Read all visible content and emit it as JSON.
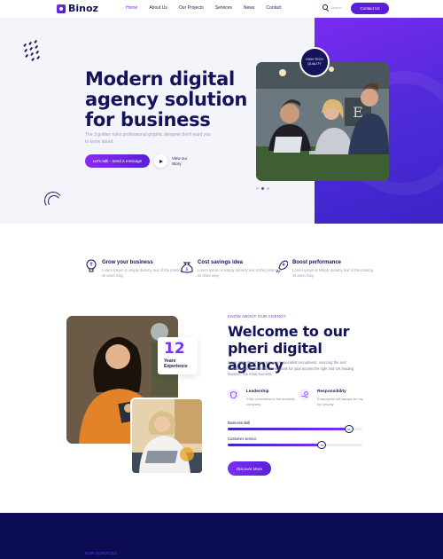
{
  "brand": {
    "name": "Binoz",
    "accent": "#7b2ff7",
    "navy": "#14145a"
  },
  "nav": {
    "items": [
      {
        "label": "Home",
        "active": true
      },
      {
        "label": "About Us",
        "active": false
      },
      {
        "label": "Our Projects",
        "active": false
      },
      {
        "label": "Services",
        "active": false
      },
      {
        "label": "News",
        "active": false
      },
      {
        "label": "Contact",
        "active": false
      }
    ],
    "search_placeholder": "Search",
    "contact_label": "Contact Us"
  },
  "hero": {
    "title": "Modern digital agency solution for business",
    "subtitle": "The 3 golden rules professional graphic designer don't want you to know about.",
    "cta_label": "Let's talk - Send a message",
    "story_label": "View our Story",
    "badge": "HIGH TECH QUALITY"
  },
  "features": [
    {
      "icon": "lightbulb-icon",
      "title": "Grow your business",
      "text": "Lorem Ipsum is simply dummy text of the printing sit amet may."
    },
    {
      "icon": "money-bag-icon",
      "title": "Cost savings idea",
      "text": "Lorem Ipsum is simply dummy text of the printing sit amet may."
    },
    {
      "icon": "rocket-icon",
      "title": "Boost performance",
      "text": "Lorem Ipsum is simply dummy text of the printing sit amet may."
    }
  ],
  "about": {
    "kicker": "KNOW ABOUT OUR AGENCY",
    "title": "Welcome to our pheri digital agency",
    "text": "Since 1985 Reed has pioneered specialist recruitment, sourcing the and knowledgeable, skilled professionals for jobs across the right mid-UK leading finance. The most success.",
    "experience_years": "12",
    "experience_label": "Years Experience",
    "highlights": [
      {
        "icon": "shield-icon",
        "title": "Leadership",
        "text": "Fully committed to the success company"
      },
      {
        "icon": "hand-coin-icon",
        "title": "Responsibility",
        "text": "Employees will always be my top priority"
      }
    ],
    "skills": [
      {
        "label": "Business skill",
        "percent": 90,
        "knob": "90"
      },
      {
        "label": "Customer service",
        "percent": 70,
        "knob": "70"
      }
    ],
    "discover_label": "Discover More"
  },
  "services": {
    "kicker": "OUR SERVICES"
  }
}
